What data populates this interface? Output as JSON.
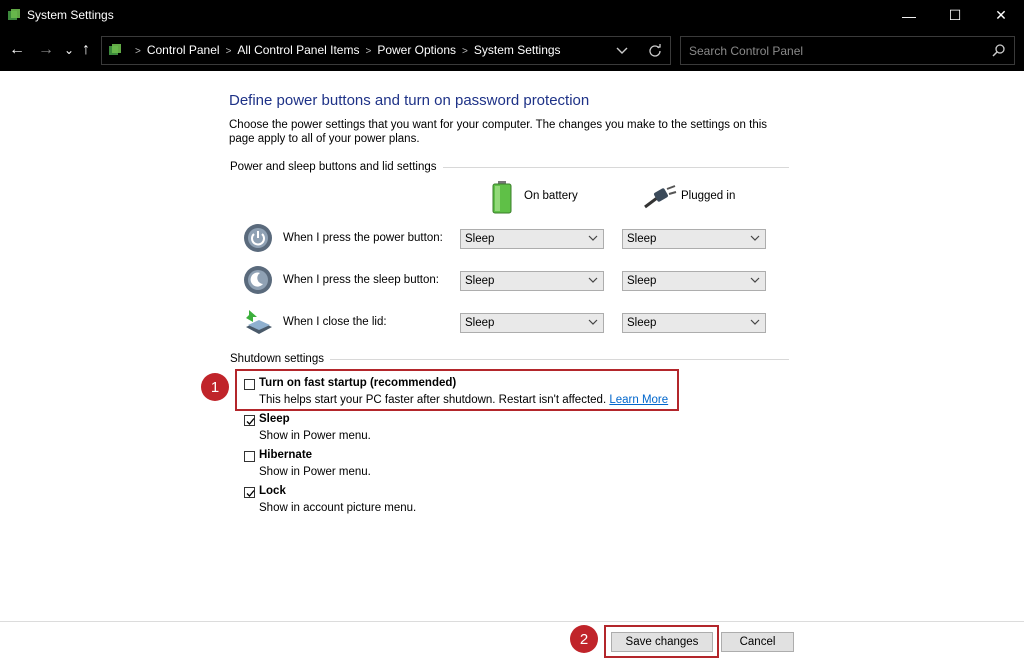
{
  "window": {
    "title": "System Settings",
    "minimize_glyph": "—",
    "maximize_glyph": "☐",
    "close_glyph": "✕"
  },
  "nav": {
    "back": "←",
    "forward": "→",
    "recent": "⌄",
    "up": "↑"
  },
  "breadcrumbs": [
    "Control Panel",
    "All Control Panel Items",
    "Power Options",
    "System Settings"
  ],
  "breadcrumb_sep": ">",
  "search": {
    "placeholder": "Search Control Panel"
  },
  "page": {
    "heading": "Define power buttons and turn on password protection",
    "intro": "Choose the power settings that you want for your computer. The changes you make to the settings on this page apply to all of your power plans."
  },
  "buttons_group": {
    "label": "Power and sleep buttons and lid settings",
    "col_battery": "On battery",
    "col_plugged": "Plugged in",
    "rows": [
      {
        "label": "When I press the power button:",
        "battery": "Sleep",
        "plugged": "Sleep"
      },
      {
        "label": "When I press the sleep button:",
        "battery": "Sleep",
        "plugged": "Sleep"
      },
      {
        "label": "When I close the lid:",
        "battery": "Sleep",
        "plugged": "Sleep"
      }
    ]
  },
  "shutdown": {
    "label": "Shutdown settings",
    "options": [
      {
        "title": "Turn on fast startup (recommended)",
        "desc": "This helps start your PC faster after shutdown. Restart isn't affected.",
        "link": "Learn More",
        "checked": false
      },
      {
        "title": "Sleep",
        "desc": "Show in Power menu.",
        "checked": true
      },
      {
        "title": "Hibernate",
        "desc": "Show in Power menu.",
        "checked": false
      },
      {
        "title": "Lock",
        "desc": "Show in account picture menu.",
        "checked": true
      }
    ]
  },
  "markers": [
    "1",
    "2"
  ],
  "footer": {
    "save": "Save changes",
    "cancel": "Cancel"
  },
  "colors": {
    "heading": "#1e3287",
    "link": "#0066cc",
    "highlight": "#b3262b"
  }
}
